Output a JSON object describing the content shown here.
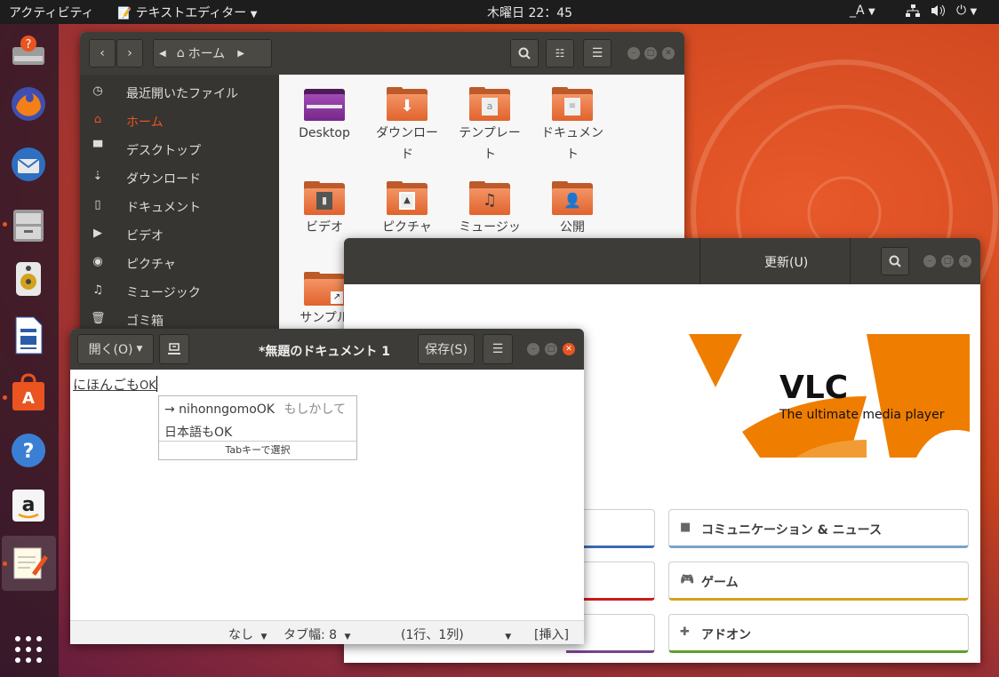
{
  "topbar": {
    "activities": "アクティビティ",
    "app_menu": "テキストエディター",
    "clock": "木曜日 22：45",
    "input_method": "_A"
  },
  "files": {
    "path_label": "ホーム",
    "sidebar": [
      "最近開いたファイル",
      "ホーム",
      "デスクトップ",
      "ダウンロード",
      "ドキュメント",
      "ビデオ",
      "ピクチャ",
      "ミュージック",
      "ゴミ箱"
    ],
    "items": [
      {
        "name": "Desktop"
      },
      {
        "name": "ダウンロー\nド"
      },
      {
        "name": "テンプレー\nト"
      },
      {
        "name": "ドキュメン\nト"
      },
      {
        "name": "ビデオ"
      },
      {
        "name": "ピクチャ"
      },
      {
        "name": "ミュージッ\nク"
      },
      {
        "name": "公開"
      },
      {
        "name": "サンプル"
      }
    ]
  },
  "software": {
    "tab_updates": "更新(U)",
    "banner_title": "VLC",
    "banner_subtitle": "The ultimate media player",
    "categories": [
      {
        "label": "コミュニケーション & ニュース",
        "color": "#7aa2c8"
      },
      {
        "label": "ゲーム",
        "color": "#d5a21a"
      },
      {
        "label": "アドオン",
        "color": "#5fa02b"
      }
    ]
  },
  "gedit": {
    "open_label": "開く(O)",
    "title": "*無題のドキュメント 1",
    "save_label": "保存(S)",
    "text_preedit": "にほんごも",
    "text_ascii": "OK",
    "ime": {
      "candidate1": "→ nihonngomoOK",
      "hint": "もしかして",
      "candidate2": "日本語もOK",
      "footer": "Tabキーで選択"
    },
    "status": {
      "syntax": "なし",
      "tab_width": "タブ幅: 8",
      "position": "(1行、1列)",
      "mode": "[挿入]"
    }
  }
}
